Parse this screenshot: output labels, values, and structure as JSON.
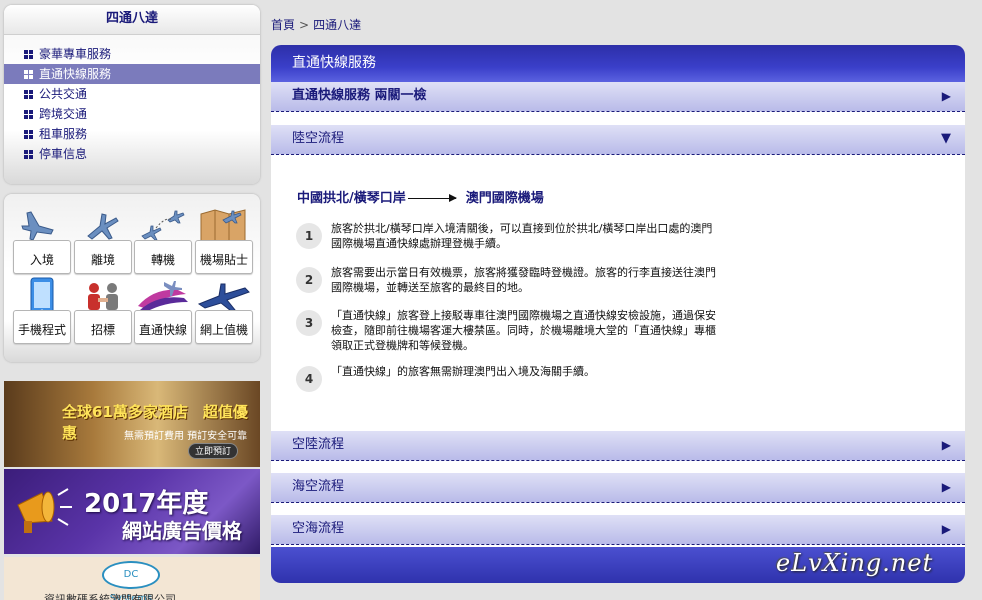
{
  "sidebar": {
    "title": "四通八達",
    "items": [
      {
        "label": "豪華專車服務",
        "active": false
      },
      {
        "label": "直通快線服務",
        "active": true
      },
      {
        "label": "公共交通",
        "active": false
      },
      {
        "label": "跨境交通",
        "active": false
      },
      {
        "label": "租車服務",
        "active": false
      },
      {
        "label": "停車信息",
        "active": false
      }
    ]
  },
  "quick_links": [
    {
      "label": "入境",
      "icon": "plane-arrival-icon"
    },
    {
      "label": "離境",
      "icon": "plane-departure-icon"
    },
    {
      "label": "轉機",
      "icon": "plane-transfer-icon"
    },
    {
      "label": "機場貼士",
      "icon": "airport-tips-icon"
    },
    {
      "label": "手機程式",
      "icon": "mobile-app-icon"
    },
    {
      "label": "招標",
      "icon": "tender-icon"
    },
    {
      "label": "直通快線",
      "icon": "express-icon"
    },
    {
      "label": "網上值機",
      "icon": "online-checkin-icon"
    }
  ],
  "banners": {
    "hotel": {
      "headline": "全球61萬多家酒店　超值優惠",
      "sub": "無需預訂費用 預訂安全可靠",
      "button": "立即預訂"
    },
    "ads": {
      "line1": "2017年度",
      "line2": "網站廣告價格"
    },
    "dc": {
      "logo": "DC Systems",
      "name": "資訊數碼系統澳門有限公司"
    }
  },
  "breadcrumb": {
    "home": "首頁",
    "separator": ">",
    "current": "四通八達"
  },
  "panel": {
    "title": "直通快線服務",
    "sections": [
      {
        "label": "直通快線服務 兩關一檢",
        "state": "collapsed"
      },
      {
        "label": "陸空流程",
        "state": "expanded"
      },
      {
        "label": "空陸流程",
        "state": "collapsed"
      },
      {
        "label": "海空流程",
        "state": "collapsed"
      },
      {
        "label": "空海流程",
        "state": "collapsed"
      }
    ],
    "route": {
      "origin": "中國拱北/橫琴口岸",
      "destination": "澳門國際機場"
    },
    "steps": [
      {
        "num": "1",
        "text": "旅客於拱北/橫琴口岸入境清關後，可以直接到位於拱北/橫琴口岸出口處的澳門國際機場直通快線處辦理登機手續。"
      },
      {
        "num": "2",
        "text": "旅客需要出示當日有效機票，旅客將獲發臨時登機證。旅客的行李直接送往澳門國際機場，並轉送至旅客的最終目的地。"
      },
      {
        "num": "3",
        "text": "「直通快線」旅客登上接駁專車往澳門國際機場之直通快線安檢設施，通過保安檢查，隨即前往機場客運大樓禁區。同時，於機場離境大堂的「直通快線」專櫃領取正式登機牌和等候登機。"
      },
      {
        "num": "4",
        "text": "「直通快線」的旅客無需辦理澳門出入境及海關手續。"
      }
    ],
    "arrow_collapsed": "▶",
    "arrow_expanded": "▼"
  },
  "watermark": "eLvXing.net"
}
